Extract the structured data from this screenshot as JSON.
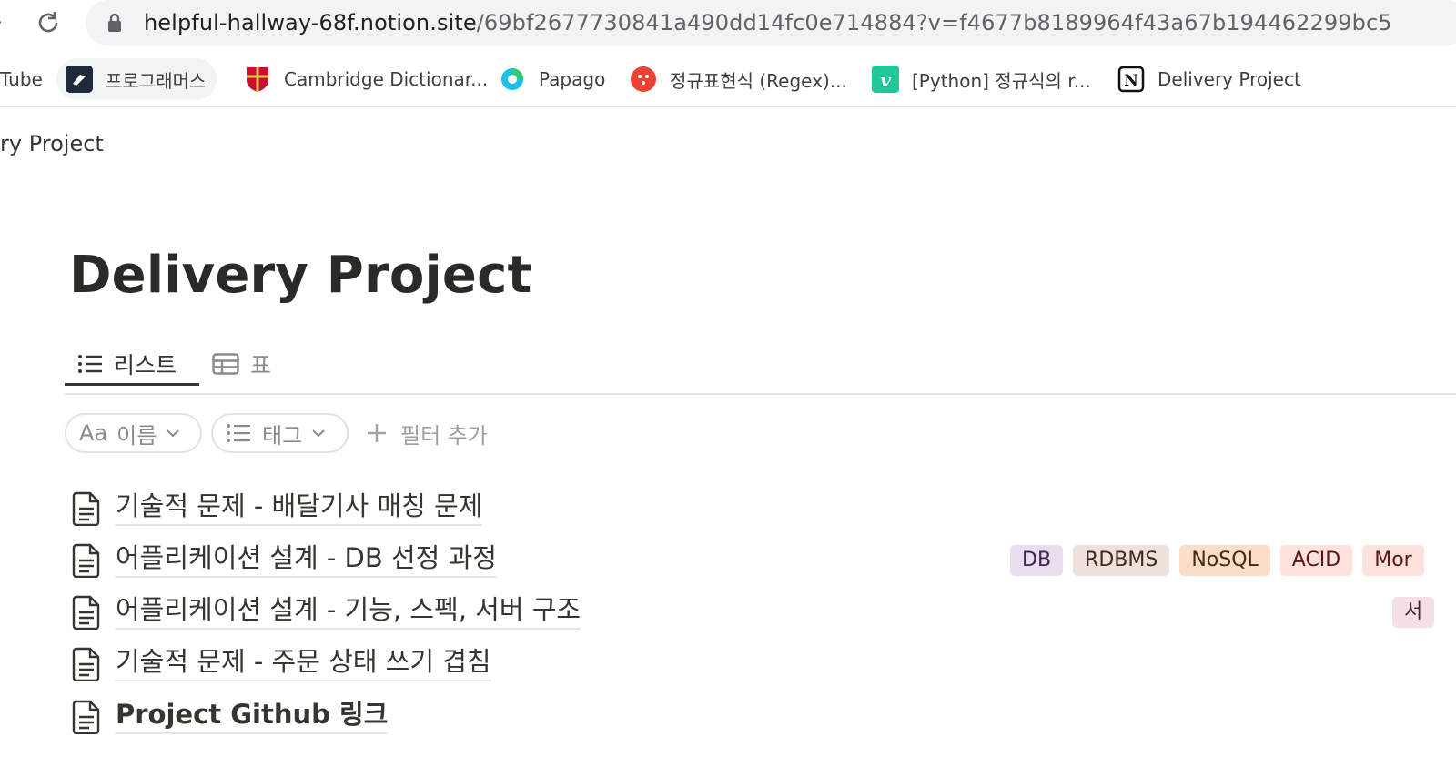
{
  "browser": {
    "url_host": "helpful-hallway-68f.notion.site",
    "url_path": "/69bf2677730841a490dd14fc0e714884?v=f4677b8189964f43a67b194462299bc5"
  },
  "bookmarks": [
    {
      "label": "Tube",
      "icon": "youtube-icon"
    },
    {
      "label": "프로그래머스",
      "icon": "programmers-icon"
    },
    {
      "label": "Cambridge Dictionar...",
      "icon": "cambridge-crest-icon"
    },
    {
      "label": "Papago",
      "icon": "papago-icon"
    },
    {
      "label": "정규표현식 (Regex)...",
      "icon": "regex-icon"
    },
    {
      "label": "[Python] 정규식의 r...",
      "icon": "velog-icon"
    },
    {
      "label": "Delivery Project",
      "icon": "notion-icon"
    }
  ],
  "breadcrumb": "ry Project",
  "page": {
    "title": "Delivery Project"
  },
  "views": [
    {
      "label": "리스트",
      "icon": "list-icon",
      "active": true
    },
    {
      "label": "표",
      "icon": "table-icon",
      "active": false
    }
  ],
  "filters": {
    "name": {
      "prefix": "Aa",
      "label": "이름"
    },
    "tag": {
      "label": "태그"
    },
    "add_label": "필터 추가"
  },
  "items": [
    {
      "title": "기술적 문제 - 배달기사 매칭 문제",
      "tags": []
    },
    {
      "title": "어플리케이션 설계 - DB 선정 과정",
      "tags": [
        {
          "label": "DB",
          "bg": "#e8deee",
          "fg": "#412454"
        },
        {
          "label": "RDBMS",
          "bg": "#eee0da",
          "fg": "#442a1e"
        },
        {
          "label": "NoSQL",
          "bg": "#fadec9",
          "fg": "#49290e"
        },
        {
          "label": "ACID",
          "bg": "#ffe2dd",
          "fg": "#5d1715"
        },
        {
          "label": "Mor",
          "bg": "#ffe2dd",
          "fg": "#5d1715"
        }
      ]
    },
    {
      "title": "어플리케이션 설계 - 기능, 스펙, 서버 구조",
      "tags": [
        {
          "label": "서",
          "bg": "#f5e0e9",
          "fg": "#4c2337"
        }
      ]
    },
    {
      "title": "기술적 문제 - 주문 상태 쓰기 겹침",
      "tags": []
    },
    {
      "title": "Project Github 링크",
      "tags": []
    }
  ]
}
